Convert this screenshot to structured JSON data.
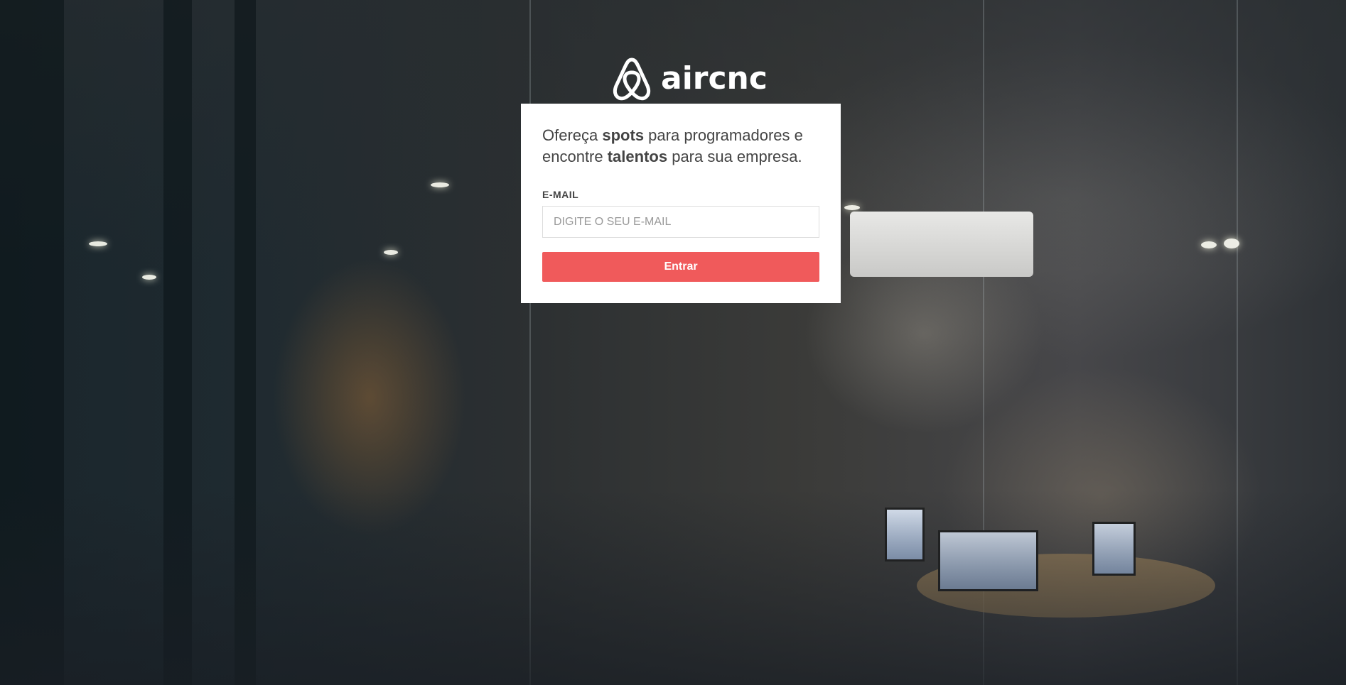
{
  "brand": {
    "name": "aircnc",
    "logo_icon": "airbnb-belo-icon",
    "logo_color": "#ffffff"
  },
  "card": {
    "headline_prefix": "Ofereça ",
    "headline_bold1": "spots",
    "headline_mid": " para programadores e encontre ",
    "headline_bold2": "talentos",
    "headline_suffix": " para sua empresa.",
    "email_label": "E-MAIL",
    "email_value": "",
    "email_placeholder": "DIGITE O SEU E-MAIL",
    "submit_label": "Entrar"
  },
  "colors": {
    "accent": "#f05a5b",
    "card_background": "#ffffff",
    "text": "#444444"
  },
  "background": {
    "image_description_icon": "office-meeting-photo"
  }
}
